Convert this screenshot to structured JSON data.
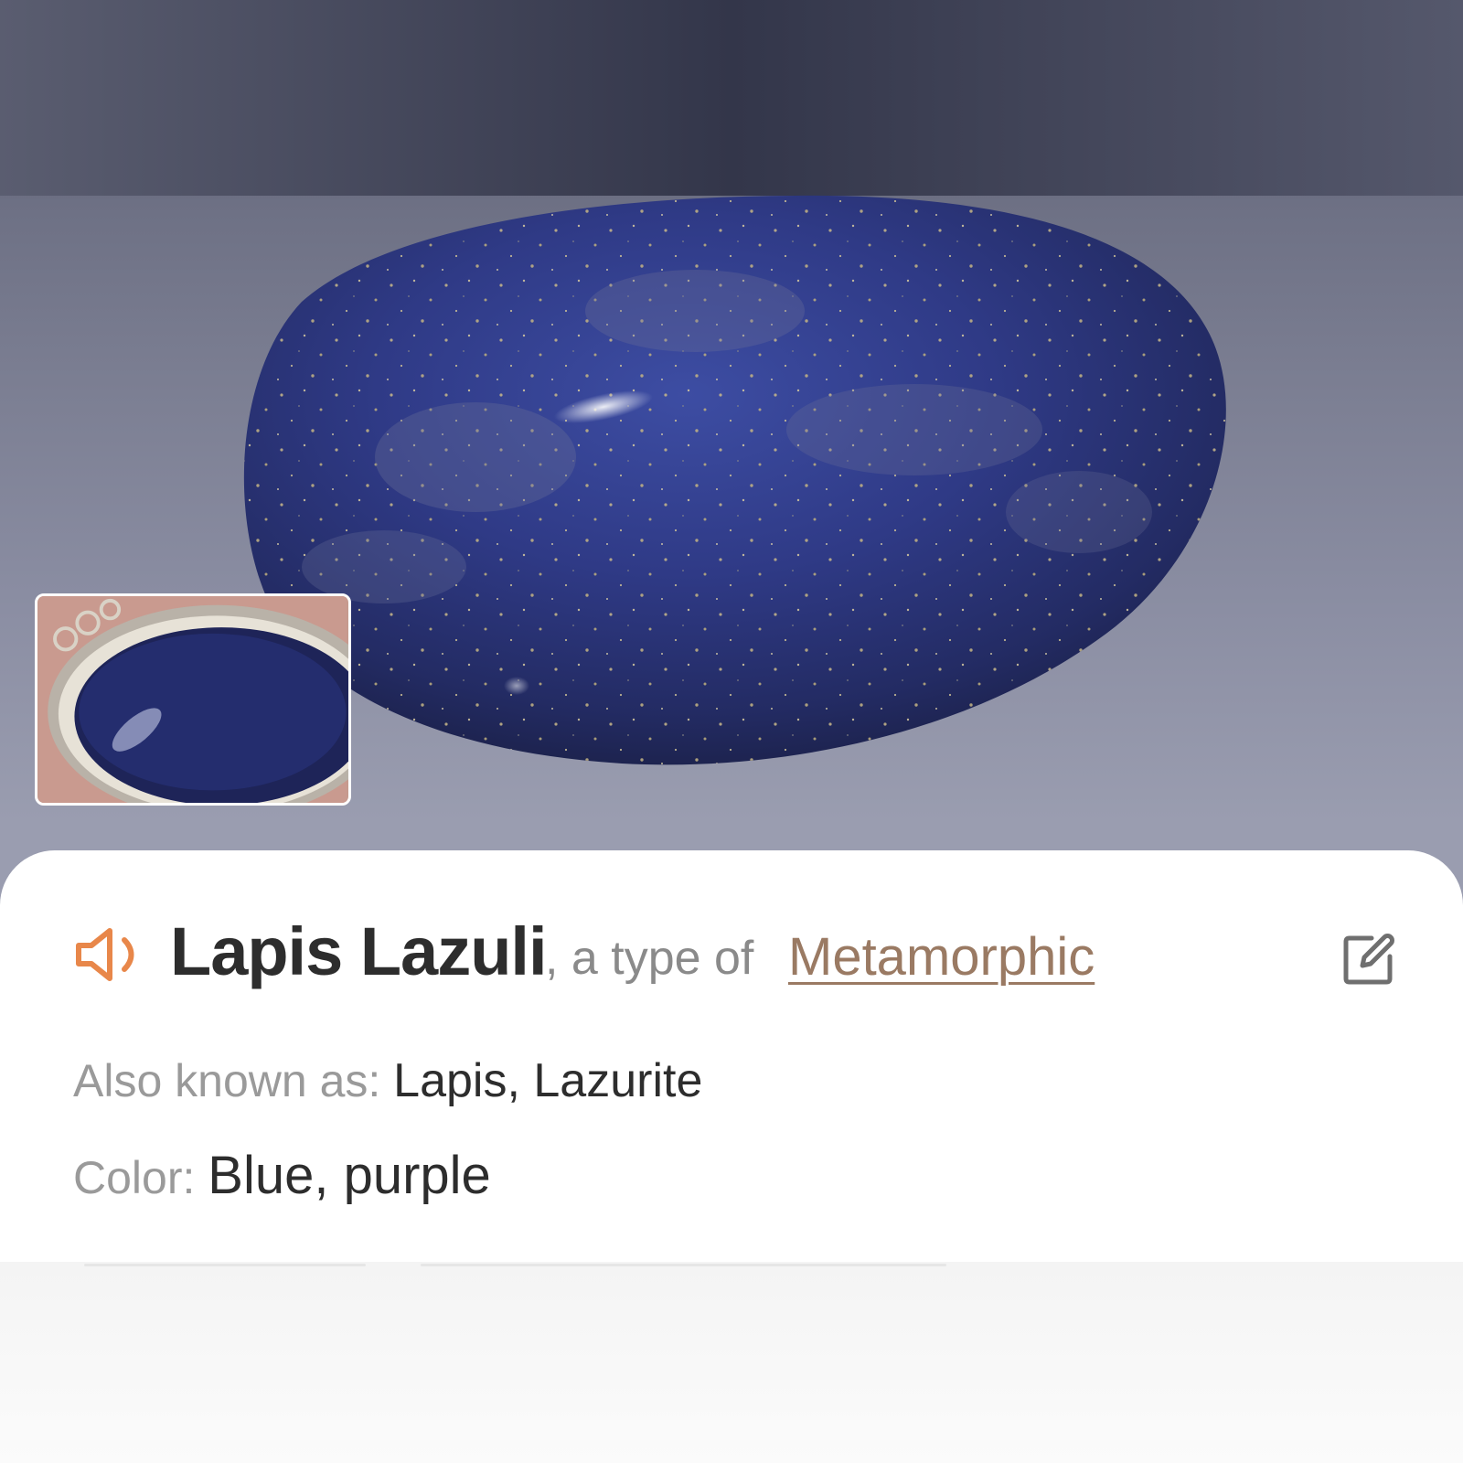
{
  "result": {
    "name": "Lapis Lazuli",
    "type_prefix": ", a type of",
    "type_link": "Metamorphic"
  },
  "details": {
    "aka_label": "Also known as:",
    "aka_value": "Lapis, Lazurite",
    "color_label": "Color:",
    "color_value": "Blue, purple"
  },
  "icons": {
    "speaker": "speaker-icon",
    "edit": "edit-icon"
  },
  "colors": {
    "accent": "#e8874a",
    "link": "#9a7a63",
    "stone": "#2b3470"
  }
}
